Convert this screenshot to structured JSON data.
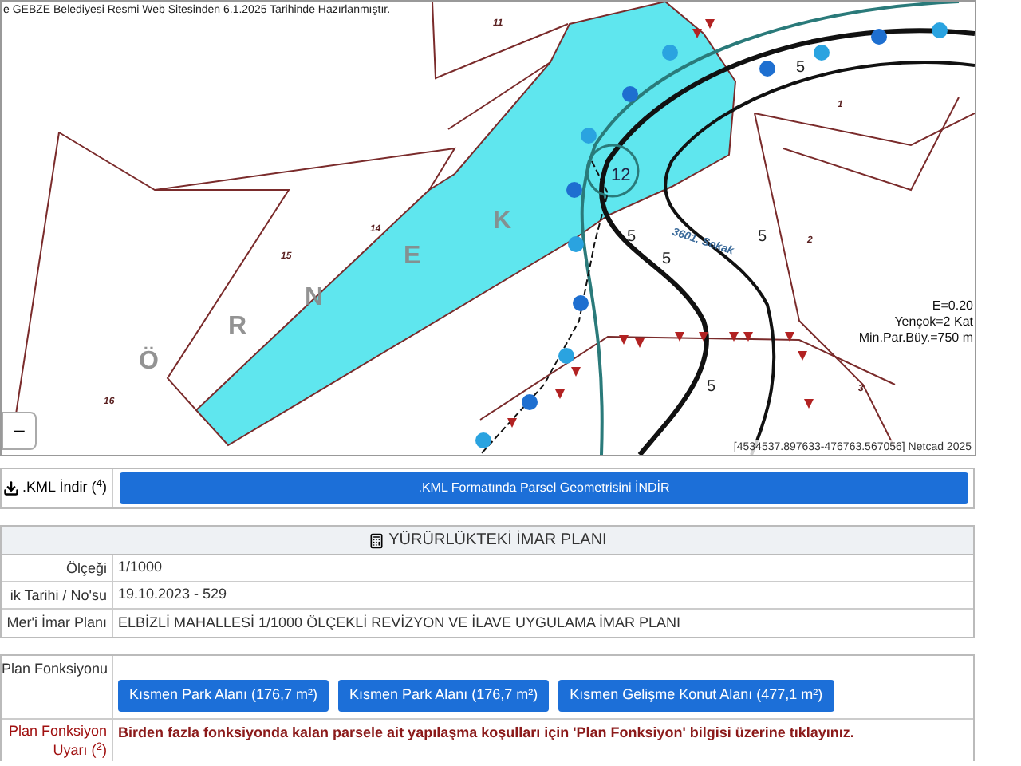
{
  "map": {
    "notice": "e GEBZE Belediyesi Resmi Web Sitesinden 6.1.2025 Tarihinde Hazırlanmıştır.",
    "parcel_labels": [
      "11",
      "14",
      "15",
      "16",
      "1",
      "2",
      "3"
    ],
    "parcel_number": "12",
    "road_width_labels": [
      "5",
      "5",
      "5",
      "5",
      "5"
    ],
    "area_letters": [
      "Ö",
      "R",
      "N",
      "E",
      "K"
    ],
    "road_label": "3601. Sokak",
    "zoning_notes": [
      "E=0.20",
      "Yençok=2 Kat",
      "Min.Par.Büy.=750 m"
    ],
    "coordinates": "[4534537.897633-476763.567056] Netcad 2025",
    "zoom_out": "−"
  },
  "kml": {
    "label": ".KML İndir ($^{4}$)",
    "button": ".KML Formatında Parsel Geometrisini İNDİR"
  },
  "plan": {
    "title": "YÜRÜRLÜKTEKİ İMAR PLANI",
    "rows": [
      {
        "label": "Ölçeği",
        "value": "1/1000"
      },
      {
        "label": "ik Tarihi / No'su",
        "value": "19.10.2023 - 529"
      },
      {
        "label": "Mer'i İmar Planı",
        "value": "ELBİZLİ MAHALLESİ 1/1000 ÖLÇEKLİ REVİZYON VE İLAVE UYGULAMA İMAR PLANI"
      }
    ],
    "function_label": "Plan Fonksiyonu",
    "functions": [
      "Kısmen Park Alanı (176,7 m²)",
      "Kısmen Park Alanı (176,7 m²)",
      "Kısmen Gelişme Konut Alanı (477,1 m²)"
    ],
    "warning_label": "Plan Fonksiyon Uyarı ($^{2}$)",
    "warning": "Birden fazla fonksiyonda kalan parsele ait yapılaşma koşulları için 'Plan Fonksiyon' bilgisi üzerine tıklayınız."
  }
}
